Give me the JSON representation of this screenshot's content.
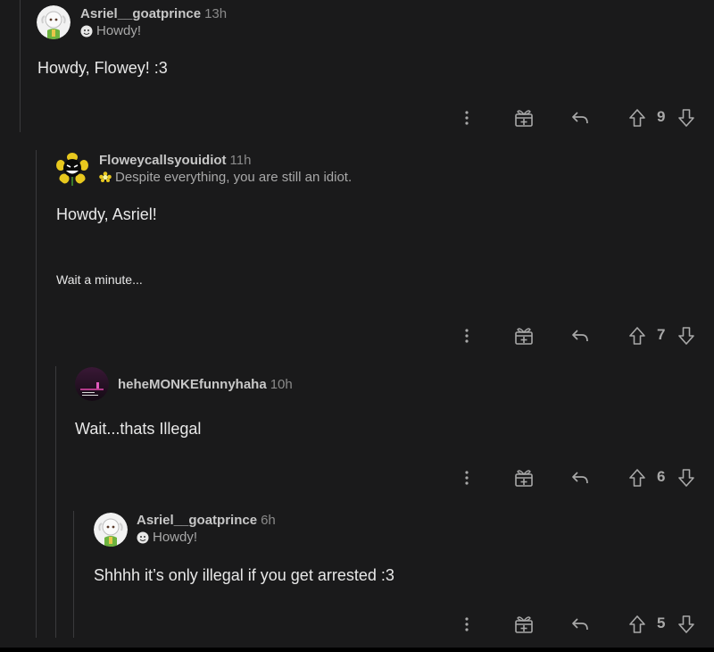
{
  "comments": [
    {
      "username": "Asriel__goatprince",
      "time": "13h",
      "flair": "Howdy!",
      "body": "Howdy, Flowey! :3",
      "score": "9"
    },
    {
      "username": "Floweycallsyouidiot",
      "time": "11h",
      "flair": "Despite everything, you are still an idiot.",
      "body": "Howdy, Asriel!",
      "body_extra": "Wait a minute...",
      "score": "7"
    },
    {
      "username": "heheMONKEfunnyhaha",
      "time": "10h",
      "body": "Wait...thats Illegal",
      "score": "6"
    },
    {
      "username": "Asriel__goatprince",
      "time": "6h",
      "flair": "Howdy!",
      "body": "Shhhh it’s only illegal if you get arrested :3",
      "score": "5"
    }
  ],
  "icons": {
    "more": "more-options-icon",
    "award": "award-icon",
    "reply": "reply-icon",
    "upvote": "upvote-icon",
    "downvote": "downvote-icon"
  },
  "colors": {
    "background": "#1a1a1b",
    "text": "#e8e8e8",
    "muted": "#a8a8a8",
    "thread_line": "#3a3a3c"
  }
}
